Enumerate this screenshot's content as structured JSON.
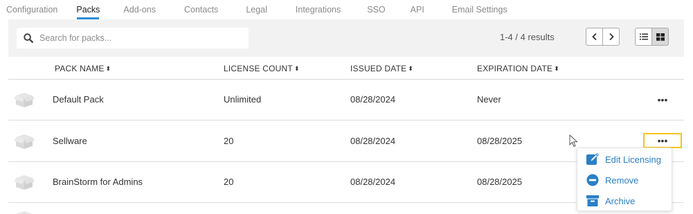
{
  "tabs": [
    {
      "label": "Configuration",
      "active": false
    },
    {
      "label": "Packs",
      "active": true
    },
    {
      "label": "Add-ons",
      "active": false
    },
    {
      "label": "Contacts",
      "active": false
    },
    {
      "label": "Legal",
      "active": false
    },
    {
      "label": "Integrations",
      "active": false
    },
    {
      "label": "SSO",
      "active": false
    },
    {
      "label": "API",
      "active": false
    },
    {
      "label": "Email Settings",
      "active": false
    }
  ],
  "toolbar": {
    "search_placeholder": "Search for packs...",
    "results_text": "1-4 / 4 results"
  },
  "table": {
    "columns": [
      "PACK NAME",
      "LICENSE COUNT",
      "ISSUED DATE",
      "EXPIRATION DATE"
    ],
    "sort_glyph": "⬍",
    "rows": [
      {
        "name": "Default Pack",
        "license_count": "Unlimited",
        "issued": "08/28/2024",
        "expiration": "Never"
      },
      {
        "name": "Sellware",
        "license_count": "20",
        "issued": "08/28/2024",
        "expiration": "08/28/2025"
      },
      {
        "name": "BrainStorm for Admins",
        "license_count": "20",
        "issued": "08/28/2024",
        "expiration": "08/28/2025"
      }
    ],
    "more_glyph": "•••"
  },
  "row_menu": {
    "items": [
      {
        "label": "Edit Licensing",
        "icon": "edit-icon"
      },
      {
        "label": "Remove",
        "icon": "remove-icon"
      },
      {
        "label": "Archive",
        "icon": "archive-icon"
      }
    ]
  },
  "colors": {
    "accent": "#2f8fd8",
    "menu_text": "#2a7fc6",
    "highlight": "#f5c518",
    "toolbar_bg": "#f2f2f2"
  }
}
